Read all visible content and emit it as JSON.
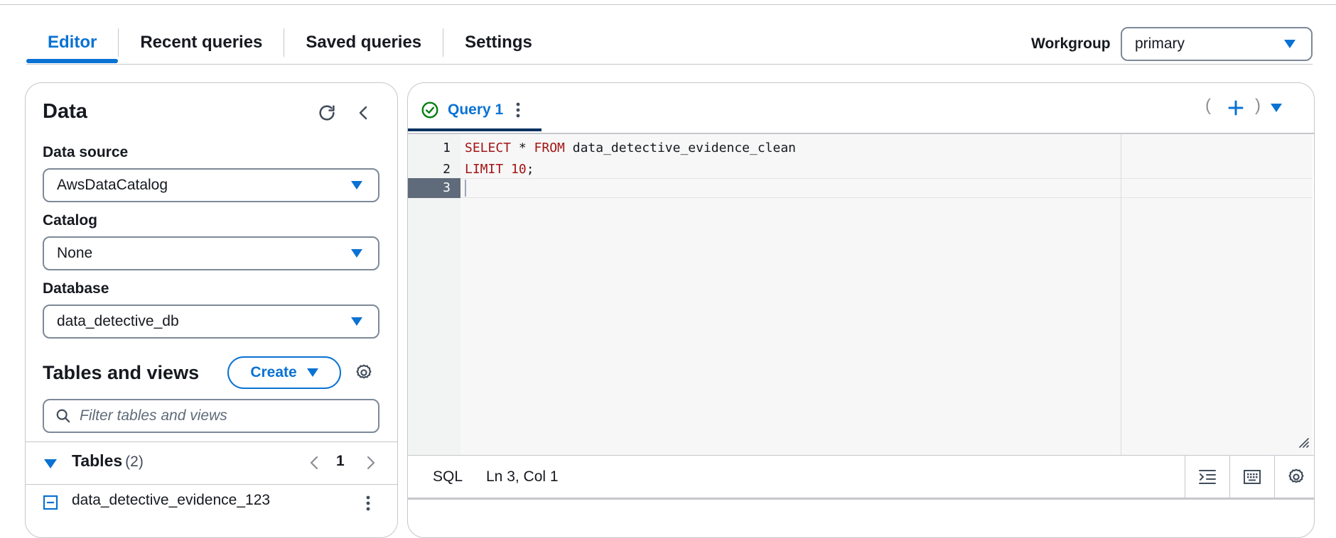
{
  "tabs": [
    {
      "label": "Editor",
      "active": true
    },
    {
      "label": "Recent queries",
      "active": false
    },
    {
      "label": "Saved queries",
      "active": false
    },
    {
      "label": "Settings",
      "active": false
    }
  ],
  "workgroup": {
    "label": "Workgroup",
    "value": "primary"
  },
  "data_panel": {
    "title": "Data",
    "data_source": {
      "label": "Data source",
      "value": "AwsDataCatalog"
    },
    "catalog": {
      "label": "Catalog",
      "value": "None"
    },
    "database": {
      "label": "Database",
      "value": "data_detective_db"
    },
    "tables_and_views": {
      "title": "Tables and views",
      "create_label": "Create",
      "filter_placeholder": "Filter tables and views"
    },
    "tables": {
      "label": "Tables",
      "count": "(2)",
      "page": "1"
    },
    "table_items": [
      {
        "name": "data_detective_evidence_123"
      }
    ]
  },
  "editor": {
    "query_tab": {
      "label": "Query 1",
      "status": "success"
    },
    "line_numbers": [
      "1",
      "2",
      "3"
    ],
    "code_lines": [
      {
        "kw1": "SELECT",
        "mid": " * ",
        "kw2": "FROM",
        "rest": " data_detective_evidence_clean"
      },
      {
        "kw1": "LIMIT",
        "mid": " ",
        "num": "10",
        "rest": ";"
      },
      {
        "text": ""
      }
    ],
    "status": {
      "language": "SQL",
      "position": "Ln 3, Col 1"
    }
  },
  "icons": {
    "refresh": "refresh-icon",
    "collapse": "chevron-left-icon",
    "settings": "gear-icon",
    "search": "search-icon",
    "table": "table-icon",
    "more": "vertical-ellipsis-icon",
    "add": "plus-icon",
    "format": "format-indent-icon",
    "keyboard": "keyboard-icon"
  },
  "colors": {
    "accent": "#0972d3",
    "success": "#037f0c",
    "keyword": "#a31515"
  }
}
